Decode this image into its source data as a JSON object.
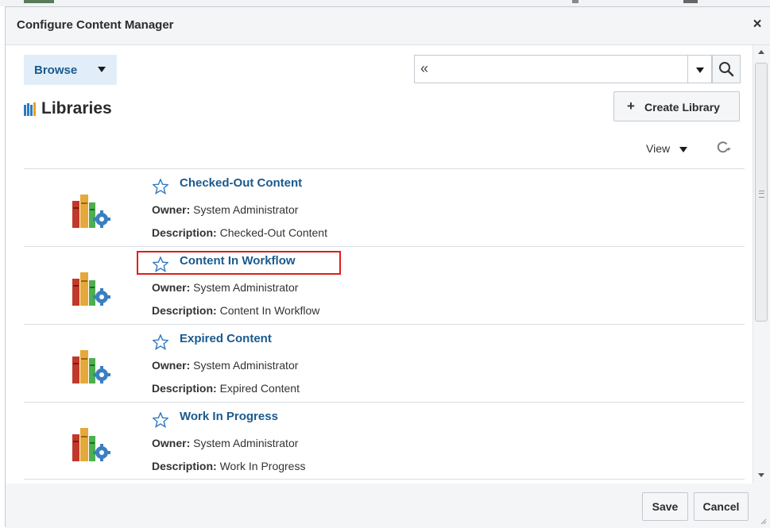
{
  "dialog": {
    "title": "Configure Content Manager",
    "close_icon": "close-icon"
  },
  "toolbar": {
    "browse_label": "Browse",
    "search_collapse_glyph": "«",
    "search_value": "",
    "search_placeholder": ""
  },
  "libraries": {
    "heading": "Libraries",
    "create_label": "Create Library",
    "create_icon": "plus-icon",
    "view_label": "View",
    "items": [
      {
        "title": "Checked-Out Content",
        "owner_label": "Owner:",
        "owner": "System Administrator",
        "description_label": "Description:",
        "description": "Checked-Out Content",
        "highlighted": false
      },
      {
        "title": "Content In Workflow",
        "owner_label": "Owner:",
        "owner": "System Administrator",
        "description_label": "Description:",
        "description": "Content In Workflow",
        "highlighted": true
      },
      {
        "title": "Expired Content",
        "owner_label": "Owner:",
        "owner": "System Administrator",
        "description_label": "Description:",
        "description": "Expired Content",
        "highlighted": false
      },
      {
        "title": "Work In Progress",
        "owner_label": "Owner:",
        "owner": "System Administrator",
        "description_label": "Description:",
        "description": "Work In Progress",
        "highlighted": false
      }
    ]
  },
  "footer": {
    "save_label": "Save",
    "cancel_label": "Cancel"
  },
  "colors": {
    "link": "#1a5a8e",
    "highlight_border": "#e01d1d",
    "browse_bg": "#e1eef9"
  }
}
